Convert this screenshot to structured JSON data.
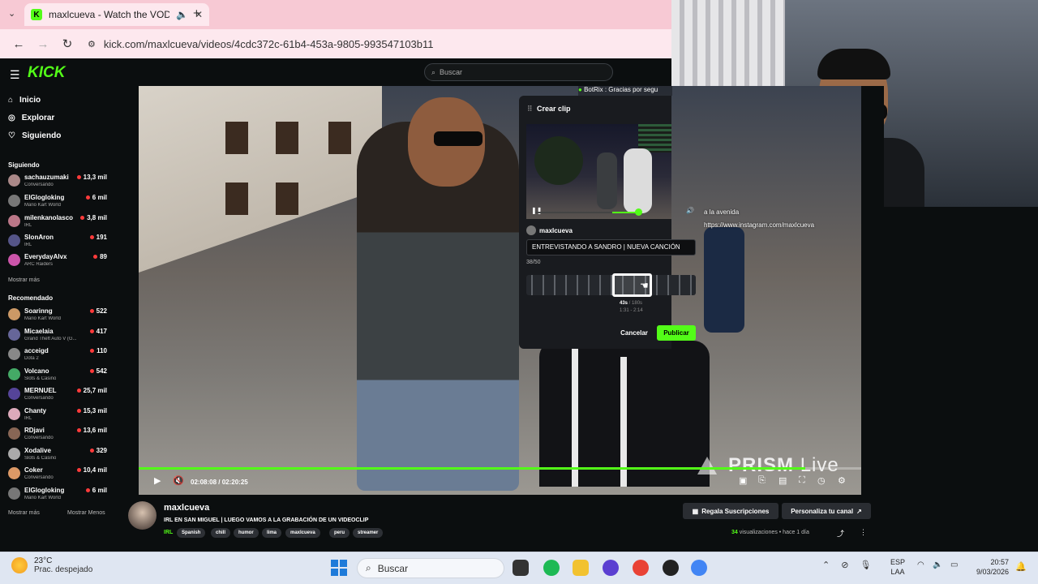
{
  "browser": {
    "tab_title": "maxlcueva - Watch the VOD",
    "tab_icons": [
      "kick-favicon-icon",
      "speaker-icon",
      "close-icon",
      "new-tab-icon",
      "tab-list-icon"
    ],
    "url": "kick.com/maxlcueva/videos/4cdc372c-61b4-453a-9805-993547103b11"
  },
  "kick": {
    "logo_text": "KICK",
    "search_placeholder": "Buscar",
    "nav": [
      {
        "label": "Inicio",
        "icon": "home-icon"
      },
      {
        "label": "Explorar",
        "icon": "compass-icon"
      },
      {
        "label": "Siguiendo",
        "icon": "heart-icon"
      }
    ],
    "following_header": "Siguiendo",
    "following": [
      {
        "name": "sachauzumaki",
        "sub": "Conversando",
        "viewers": "13,3 mil"
      },
      {
        "name": "ElGlogloking",
        "sub": "Mario Kart World",
        "viewers": "6 mil"
      },
      {
        "name": "milenkanolasco",
        "sub": "IRL",
        "viewers": "3,8 mil"
      },
      {
        "name": "SlonAron",
        "sub": "IRL",
        "viewers": "191"
      },
      {
        "name": "EverydayAlvx",
        "sub": "ARC Raiders",
        "viewers": "89"
      }
    ],
    "show_more": "Mostrar más",
    "recommended_header": "Recomendado",
    "recommended": [
      {
        "name": "Soarinng",
        "sub": "Mario Kart World",
        "viewers": "522"
      },
      {
        "name": "Micaelaia",
        "sub": "Grand Theft Auto V (G...",
        "viewers": "417"
      },
      {
        "name": "acceigd",
        "sub": "Dota 2",
        "viewers": "110"
      },
      {
        "name": "Volcano",
        "sub": "Slots & Casino",
        "viewers": "542"
      },
      {
        "name": "MERNUEL",
        "sub": "Conversando",
        "viewers": "25,7 mil"
      },
      {
        "name": "Chanty",
        "sub": "IRL",
        "viewers": "15,3 mil"
      },
      {
        "name": "RDjavi",
        "sub": "Conversando",
        "viewers": "13,6 mil"
      },
      {
        "name": "Xodalive",
        "sub": "Slots & Casino",
        "viewers": "329"
      },
      {
        "name": "Coker",
        "sub": "Conversando",
        "viewers": "10,4 mil"
      },
      {
        "name": "ElGlogloking",
        "sub": "Mario Kart World",
        "viewers": "6 mil"
      }
    ],
    "show_more_2": "Mostrar más",
    "show_less": "Mostrar Menos"
  },
  "overlay": {
    "chat_line_1": "BotRix : Gracias por segu",
    "chat_line_2": "a la avenida",
    "chat_line_3": "https://www.instagram.com/maxlcueva",
    "watermark_brand": "PRISM",
    "watermark_live": "Live"
  },
  "player": {
    "time": "02:08:08 / 02:20:25",
    "progress_fraction": 0.922,
    "icons": [
      "play-icon",
      "mute-icon",
      "theater-icon",
      "clip-icon",
      "captions-icon",
      "fullscreen-icon",
      "speed-icon",
      "settings-icon"
    ]
  },
  "clip": {
    "title": "Crear clip",
    "username": "maxlcueva",
    "title_input": "ENTREVISTANDO A SANDRO | NUEVA CANCIÓN",
    "char_count": "38/50",
    "length": "43s",
    "max_length": " / 180s",
    "range": "1:31 - 2:14",
    "cancel": "Cancelar",
    "publish": "Publicar"
  },
  "video_info": {
    "channel": "maxlcueva",
    "title": "IRL EN SAN MIGUEL | LUEGO VAMOS A LA GRABACIÓN DE UN VIDEOCLIP",
    "category": "IRL",
    "tags": [
      "Spanish",
      "chill",
      "humor",
      "lima",
      "maxlcueva",
      "peru",
      "streamer"
    ],
    "subs_button": "Regala Suscripciones",
    "customize_button": "Personaliza tu canal",
    "views_count": "34",
    "views_label": " visualizaciones",
    "date": "• hace 1 día"
  },
  "taskbar": {
    "temp": "23°C",
    "weather": "Prac. despejado",
    "search": "Buscar",
    "lang_1": "ESP",
    "lang_2": "LAA",
    "time": "20:57",
    "date": "9/03/2026"
  },
  "colors": {
    "accent": "#53fc18",
    "background": "#0b0e0f",
    "taskbar": "#dfe6f2"
  }
}
